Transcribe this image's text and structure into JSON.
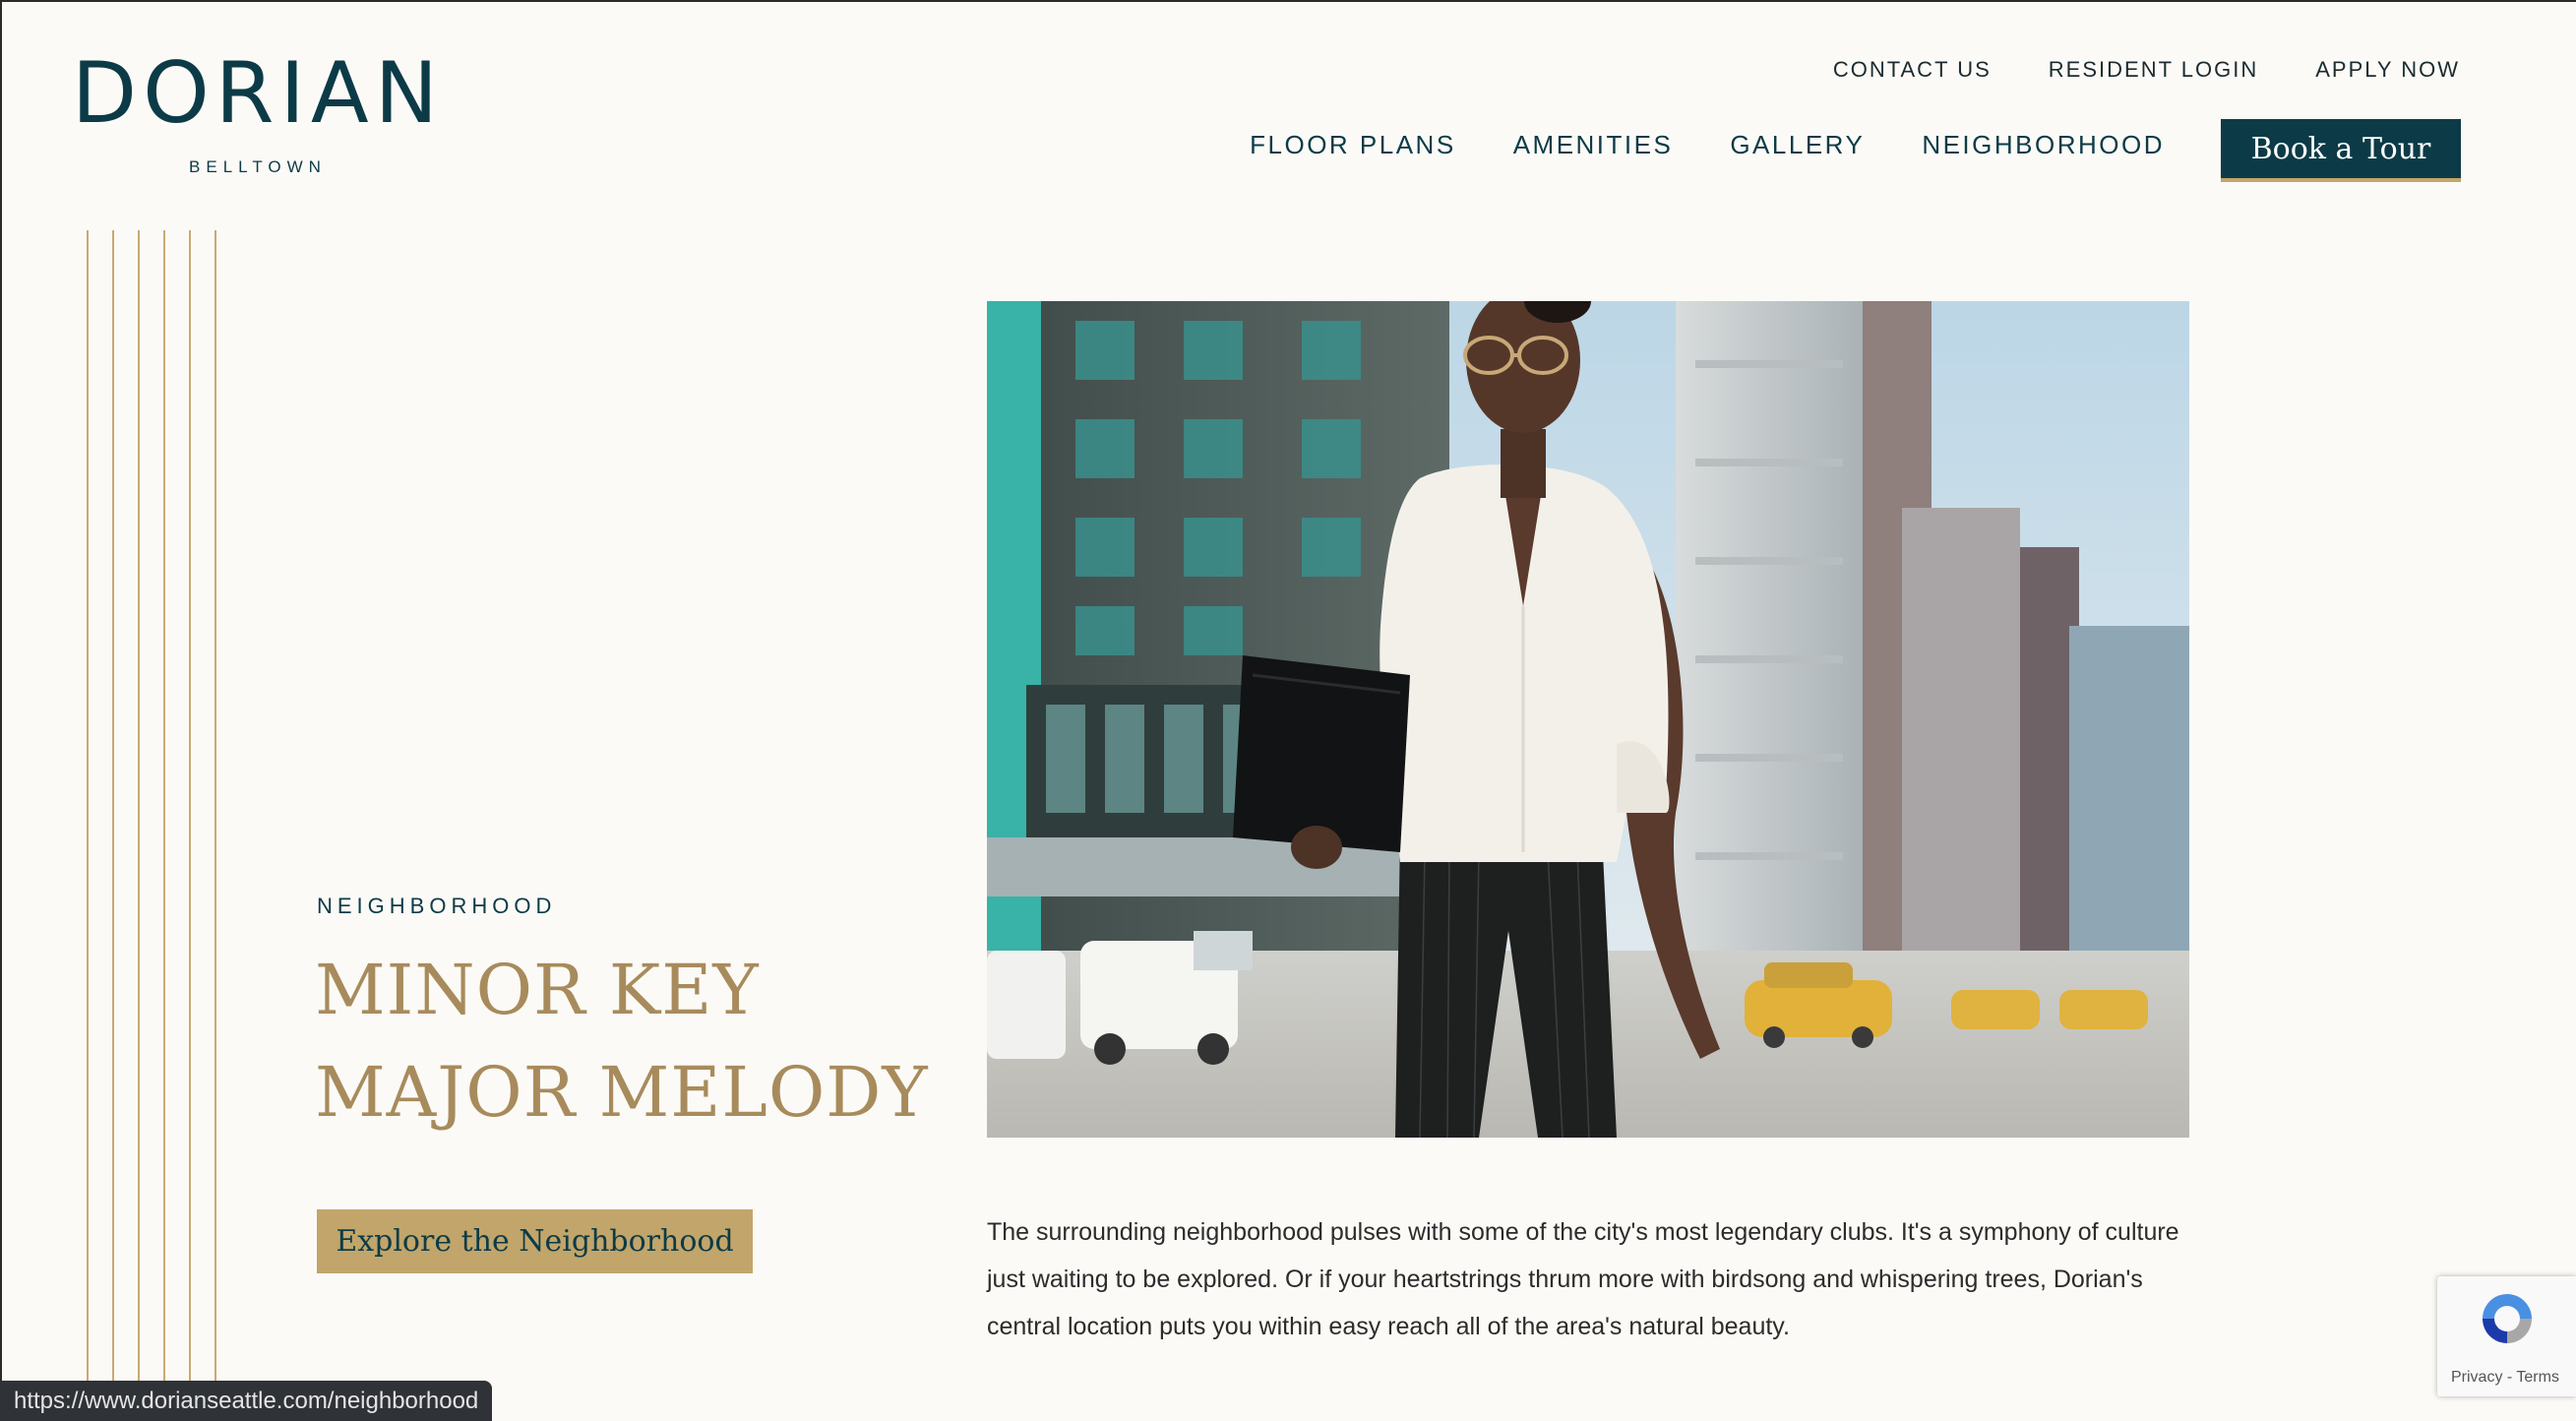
{
  "brand": {
    "name": "DORIAN",
    "location": "BELLTOWN",
    "colors": {
      "primary": "#0c3b47",
      "accent_gold": "#c2a56a",
      "headline_gold": "#a88b5c",
      "background": "#fbfaf6"
    }
  },
  "utility_nav": {
    "contact": "CONTACT US",
    "resident_login": "RESIDENT LOGIN",
    "apply": "APPLY NOW"
  },
  "main_nav": {
    "floor_plans": "FLOOR PLANS",
    "amenities": "AMENITIES",
    "gallery": "GALLERY",
    "neighborhood": "NEIGHBORHOOD",
    "cta": "Book a Tour"
  },
  "hero": {
    "eyebrow": "NEIGHBORHOOD",
    "headline_line1": "MINOR KEY",
    "headline_line2": "MAJOR MELODY",
    "button": "Explore the Neighborhood",
    "image_subject": "woman walking on a city street carrying a black portfolio, yellow taxis and buildings behind"
  },
  "body": {
    "paragraph": "The surrounding neighborhood pulses with some of the city's most legendary clubs. It's a symphony of culture just waiting to be explored. Or if your heartstrings thrum more with birdsong and whispering trees, Dorian's central location puts you within easy reach all of the area's natural beauty."
  },
  "status_bar": {
    "url": "https://www.dorianseattle.com/neighborhood"
  },
  "recaptcha": {
    "links": "Privacy - Terms",
    "icon": "recaptcha-icon"
  }
}
